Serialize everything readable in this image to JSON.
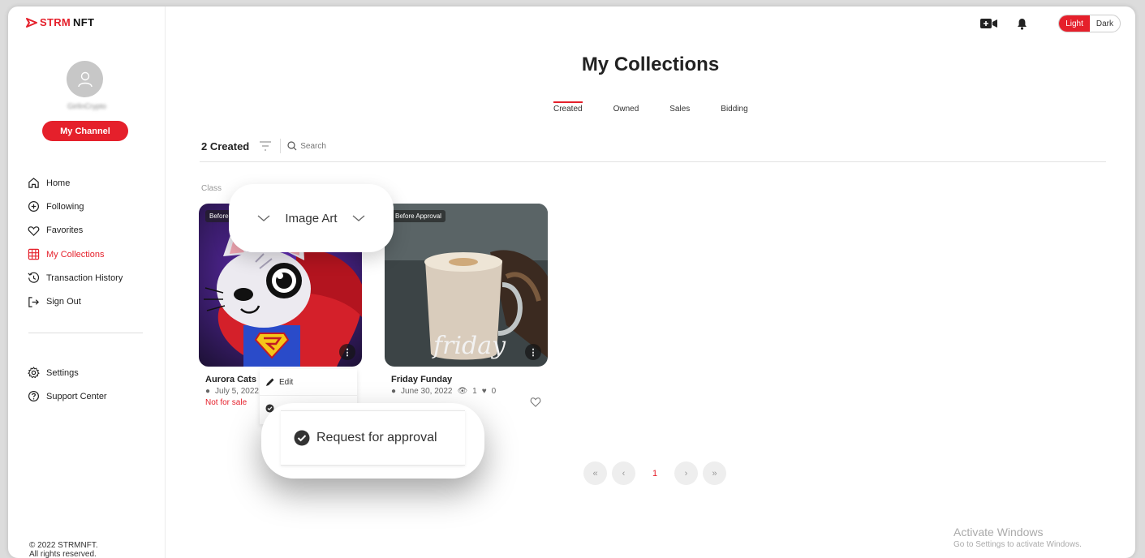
{
  "brand": {
    "name_red": "STRM",
    "name_black": "NFT"
  },
  "profile": {
    "username": "GirlInCrypto",
    "channel_button": "My Channel"
  },
  "nav": [
    {
      "label": "Home",
      "icon": "home-icon",
      "active": false
    },
    {
      "label": "Following",
      "icon": "plus-circle-icon",
      "active": false
    },
    {
      "label": "Favorites",
      "icon": "heart-icon",
      "active": false
    },
    {
      "label": "My Collections",
      "icon": "grid-icon",
      "active": true
    },
    {
      "label": "Transaction History",
      "icon": "history-icon",
      "active": false
    },
    {
      "label": "Sign Out",
      "icon": "sign-out-icon",
      "active": false
    }
  ],
  "nav2": [
    {
      "label": "Settings",
      "icon": "gear-icon"
    },
    {
      "label": "Support Center",
      "icon": "help-icon"
    }
  ],
  "footer": {
    "line1": "© 2022 STRMNFT.",
    "line2": "All rights reserved."
  },
  "topbar": {
    "theme_light": "Light",
    "theme_dark": "Dark",
    "theme_selected": "Light"
  },
  "page": {
    "title": "My Collections"
  },
  "tabs": [
    {
      "label": "Created",
      "active": true
    },
    {
      "label": "Owned",
      "active": false
    },
    {
      "label": "Sales",
      "active": false
    },
    {
      "label": "Bidding",
      "active": false
    }
  ],
  "toolbar": {
    "count_label": "2 Created",
    "search_placeholder": "Search"
  },
  "class_label": "Class",
  "cards": [
    {
      "badge": "Before",
      "name": "Aurora Cats",
      "date": "July 5, 2022",
      "status": "Not for sale"
    },
    {
      "badge": "Before Approval",
      "name": "Friday Funday",
      "date": "June 30, 2022",
      "views": "1",
      "likes": "0"
    }
  ],
  "card_menu": {
    "edit": "Edit"
  },
  "zoom": {
    "class_value": "Image Art",
    "request_approval": "Request for approval"
  },
  "pagination": {
    "current": "1",
    "first": "«",
    "prev": "‹",
    "next": "›",
    "last": "»"
  },
  "watermark": {
    "title": "Activate Windows",
    "subtitle": "Go to Settings to activate Windows."
  },
  "colors": {
    "accent": "#e5202b"
  }
}
